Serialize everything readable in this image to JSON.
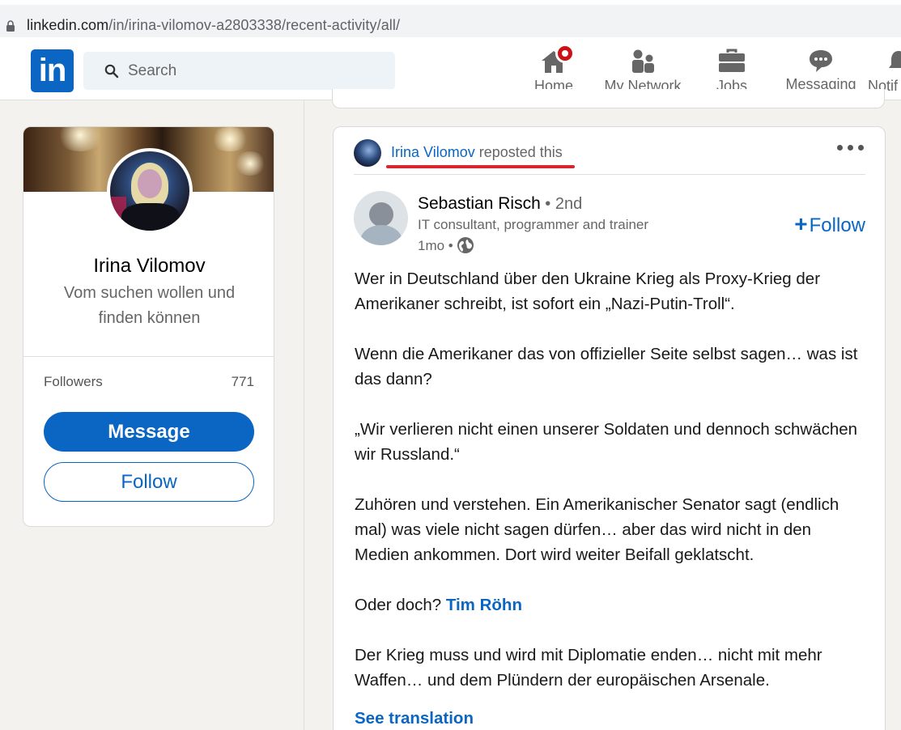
{
  "browser": {
    "url_domain": "linkedin.com",
    "url_path": "/in/irina-vilomov-a2803338/recent-activity/all/"
  },
  "nav": {
    "logo": "in",
    "search_placeholder": "Search",
    "items": [
      {
        "label": "Home",
        "icon": "home-icon"
      },
      {
        "label": "My Network",
        "icon": "network-icon"
      },
      {
        "label": "Jobs",
        "icon": "briefcase-icon"
      },
      {
        "label": "Messaging",
        "icon": "messaging-icon"
      },
      {
        "label": "Notif",
        "icon": "bell-icon"
      }
    ],
    "accent": "#0a66c2",
    "notification_color": "#cc1016"
  },
  "profile": {
    "name": "Irina Vilomov",
    "tagline": "Vom suchen wollen und finden können",
    "followers_label": "Followers",
    "followers_count": "771",
    "message_label": "Message",
    "follow_label": "Follow"
  },
  "post": {
    "repost_name": "Irina Vilomov",
    "repost_suffix": " reposted this",
    "author_name": "Sebastian Risch",
    "author_degree": " • 2nd",
    "author_title": "IT consultant, programmer and trainer",
    "author_time": "1mo •",
    "follow_label": "Follow",
    "paragraphs": [
      "Wer in Deutschland über den Ukraine Krieg als Proxy-Krieg der Amerikaner schreibt, ist sofort ein „Nazi-Putin-Troll“.",
      "Wenn die Amerikaner das von offizieller Seite selbst sagen… was ist das dann?",
      "„Wir verlieren nicht einen unserer Soldaten und dennoch schwächen wir Russland.“",
      "Zuhören und verstehen. Ein Amerikanischer Senator sagt (endlich mal) was viele nicht sagen dürfen… aber das wird nicht in den Medien ankommen. Dort wird weiter Beifall geklatscht.",
      "Der Krieg muss und wird mit Diplomatie enden… nicht mit mehr Waffen… und dem Plündern der europäischen Arsenale."
    ],
    "p5_prefix": "Oder doch? ",
    "p5_mention": "Tim Röhn",
    "see_translation": "See translation"
  }
}
